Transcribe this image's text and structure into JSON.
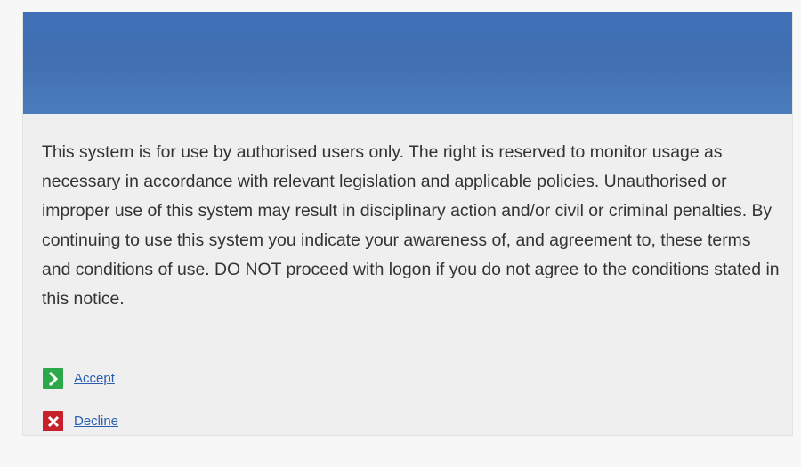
{
  "colors": {
    "banner": "#416fb0",
    "accept_icon": "#2ba84a",
    "decline_icon": "#c8202b",
    "link": "#2a5fb0",
    "text": "#333333"
  },
  "notice": {
    "text": "This system is for use by authorised users only. The right is reserved to monitor usage as necessary in accordance with relevant legislation and applicable policies. Unauthorised or improper use of this system may result in disciplinary action and/or civil or criminal penalties. By continuing to use this system you indicate your awareness of, and agreement to, these terms and conditions of use. DO NOT proceed with logon if you do not agree to the conditions stated in this notice."
  },
  "actions": {
    "accept": {
      "label": "Accept",
      "icon": "chevron-right-icon"
    },
    "decline": {
      "label": "Decline",
      "icon": "close-icon"
    }
  }
}
